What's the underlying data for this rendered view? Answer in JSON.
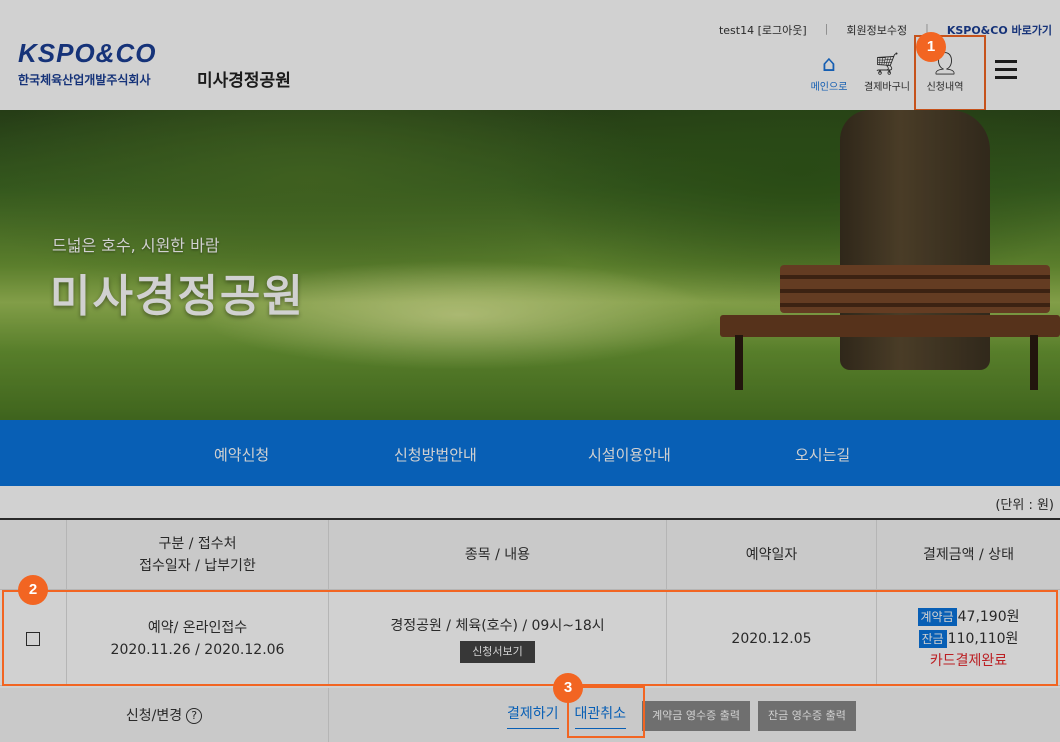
{
  "header": {
    "top_links": {
      "user": "test14 [로그아웃]",
      "member_info": "회원정보수정",
      "kspo_link": "KSPO&CO 바로가기"
    },
    "logo_text": "KSPO&CO",
    "logo_sub": "한국체육산업개발주식회사",
    "site_name": "미사경정공원",
    "nav": {
      "main_label": "메인으로",
      "cart_label": "결제바구니",
      "apply_label": "신청내역"
    }
  },
  "hero": {
    "subtitle": "드넓은 호수, 시원한 바람",
    "title": "미사경정공원"
  },
  "menu": [
    "예약신청",
    "신청방법안내",
    "시설이용안내",
    "오시는길"
  ],
  "unit_label": "(단위 : 원)",
  "table": {
    "headers": {
      "col2_line1": "구분 / 접수처",
      "col2_line2": "접수일자 / 납부기한",
      "col3": "종목 / 내용",
      "col4": "예약일자",
      "col5": "결제금액 / 상태"
    },
    "row": {
      "type_line1": "예약/ 온라인접수",
      "type_line2": "2020.11.26 / 2020.12.06",
      "content": "경정공원 / 체육(호수) / 09시~18시",
      "view_button": "신청서보기",
      "date": "2020.12.05",
      "deposit_tag": "계약금",
      "deposit_amount": "47,190원",
      "balance_tag": "잔금",
      "balance_amount": "110,110원",
      "status": "카드결제완료"
    },
    "footer": {
      "label": "신청/변경",
      "help_glyph": "?",
      "pay_button": "결제하기",
      "cancel_button": "대관취소",
      "deposit_receipt": "계약금 영수증 출력",
      "balance_receipt": "잔금 영수증 출력"
    }
  },
  "badges": [
    "1",
    "2",
    "3"
  ],
  "colors": {
    "accent": "#f26522",
    "primary": "#0a74dd",
    "brand": "#1c3f94"
  }
}
